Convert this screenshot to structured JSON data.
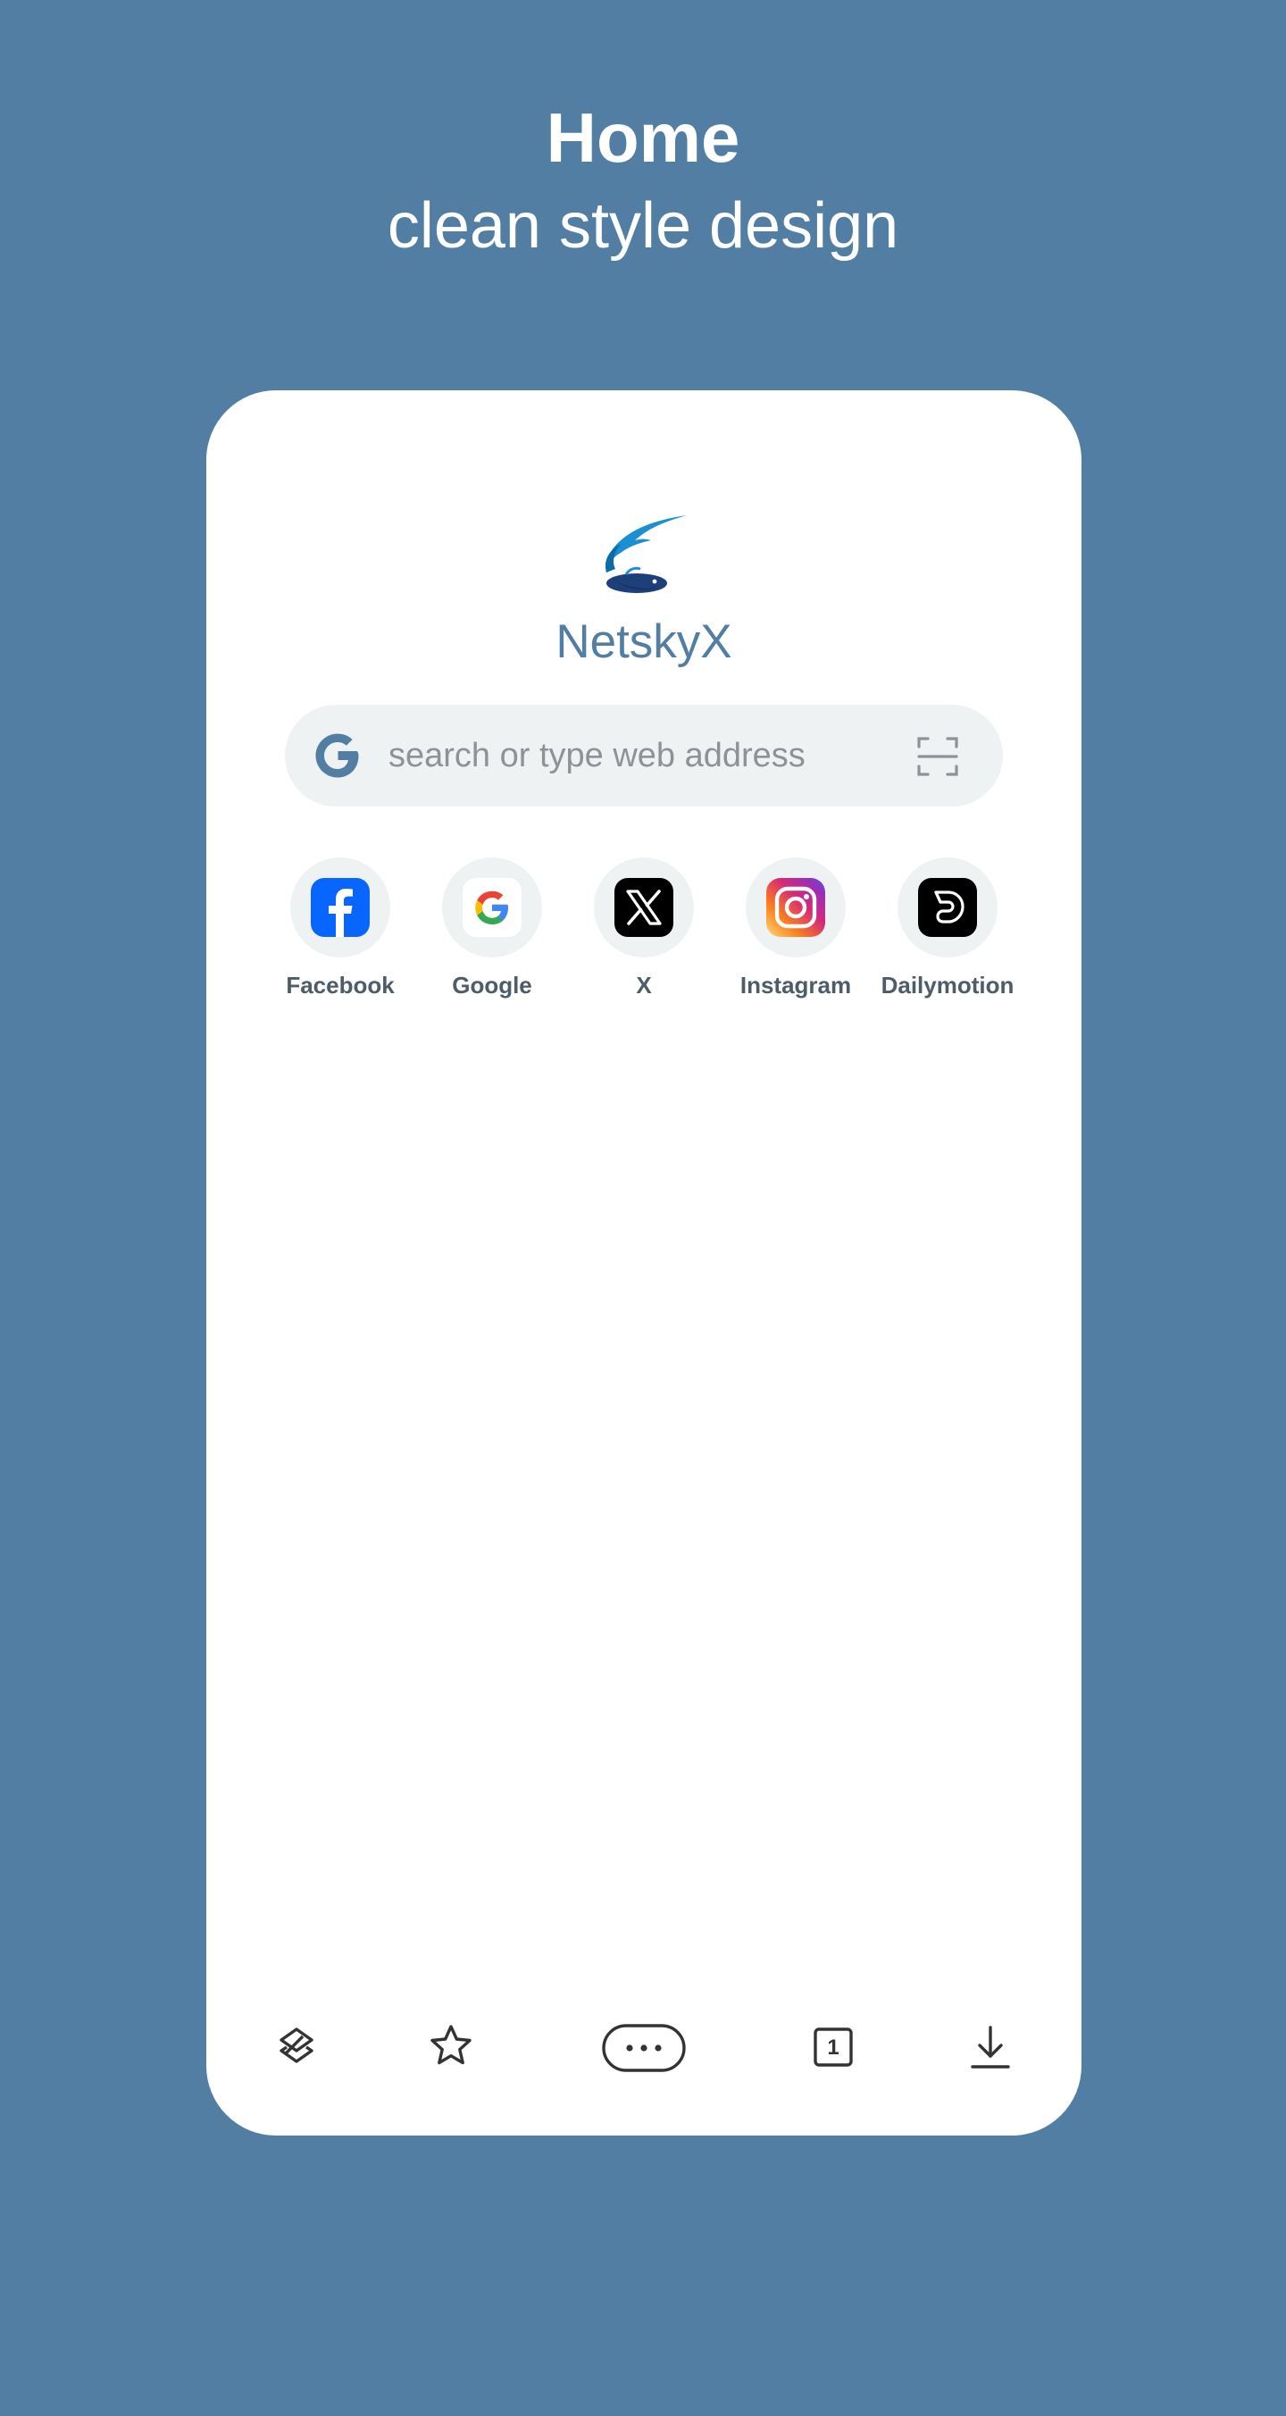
{
  "header": {
    "title": "Home",
    "subtitle": "clean style design"
  },
  "app": {
    "name": "NetskyX",
    "accent_color": "#527ea3"
  },
  "search": {
    "placeholder": "search or type web address",
    "value": "",
    "engine_icon": "google-g-icon",
    "scan_icon": "scan-icon"
  },
  "shortcuts": [
    {
      "label": "Facebook",
      "icon": "facebook-icon",
      "color": "#0866ff"
    },
    {
      "label": "Google",
      "icon": "google-icon",
      "color": "#4285f4"
    },
    {
      "label": "X",
      "icon": "x-icon",
      "color": "#000000"
    },
    {
      "label": "Instagram",
      "icon": "instagram-icon",
      "color": "#e1306c"
    },
    {
      "label": "Dailymotion",
      "icon": "dailymotion-icon",
      "color": "#000000"
    }
  ],
  "bottom_nav": {
    "items": [
      {
        "icon": "workspace-icon"
      },
      {
        "icon": "star-icon"
      },
      {
        "icon": "more-icon"
      },
      {
        "icon": "tabs-icon",
        "tab_count": "1"
      },
      {
        "icon": "download-icon"
      }
    ]
  }
}
